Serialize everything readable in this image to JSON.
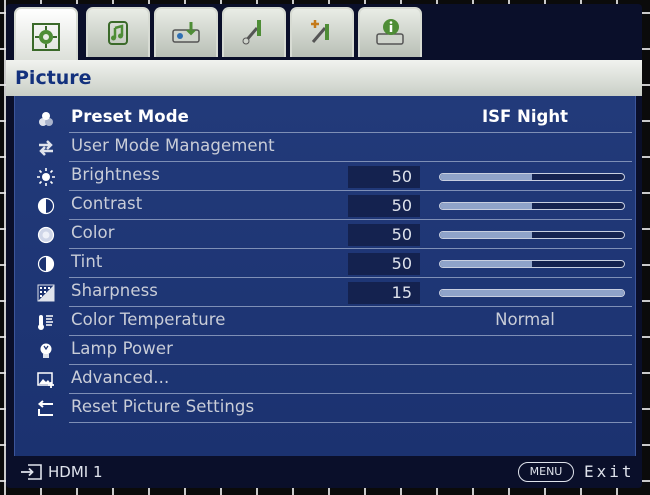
{
  "header": {
    "title": "Picture"
  },
  "tabs": [
    {
      "icon": "picture-settings-icon",
      "active": true
    },
    {
      "icon": "audio-settings-icon",
      "active": false
    },
    {
      "icon": "display-settings-icon",
      "active": false
    },
    {
      "icon": "setup-basic-icon",
      "active": false
    },
    {
      "icon": "setup-advanced-icon",
      "active": false
    },
    {
      "icon": "information-icon",
      "active": false
    }
  ],
  "menu": {
    "items": [
      {
        "label": "Preset Mode",
        "icon": "preset-mode-icon",
        "value": "ISF Night",
        "selected": true
      },
      {
        "label": "User Mode Management",
        "icon": "user-mode-icon"
      },
      {
        "label": "Brightness",
        "icon": "brightness-icon",
        "value": "50",
        "level": 0.5
      },
      {
        "label": "Contrast",
        "icon": "contrast-icon",
        "value": "50",
        "level": 0.5
      },
      {
        "label": "Color",
        "icon": "color-icon",
        "value": "50",
        "level": 0.5
      },
      {
        "label": "Tint",
        "icon": "tint-icon",
        "value": "50",
        "level": 0.5
      },
      {
        "label": "Sharpness",
        "icon": "sharpness-icon",
        "value": "15",
        "level": 1.0
      },
      {
        "label": "Color Temperature",
        "icon": "color-temperature-icon",
        "value": "Normal"
      },
      {
        "label": "Lamp Power",
        "icon": "lamp-power-icon"
      },
      {
        "label": "Advanced...",
        "icon": "advanced-icon"
      },
      {
        "label": "Reset Picture Settings",
        "icon": "reset-icon"
      }
    ]
  },
  "status": {
    "source": "HDMI 1",
    "menu_key": "MENU",
    "exit_label": "Exit"
  },
  "colors": {
    "panel_bg": "#1f3676",
    "title_text": "#13317d",
    "osd_bg": "#0a0f2a"
  }
}
